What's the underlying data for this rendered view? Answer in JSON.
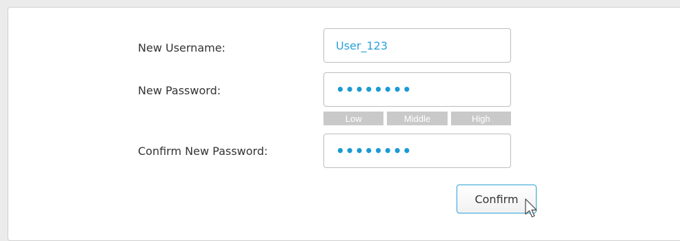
{
  "form": {
    "username_label": "New Username:",
    "username_value": "User_123",
    "password_label": "New Password:",
    "password_value": "••••••••",
    "confirm_label": "Confirm New Password:",
    "confirm_value": "••••••••"
  },
  "strength": {
    "low": "Low",
    "middle": "Middle",
    "high": "High"
  },
  "buttons": {
    "confirm": "Confirm"
  },
  "colors": {
    "accent": "#2aa1d9",
    "strength_bar": "#c9c9c9"
  },
  "icons": {
    "cursor": "mouse-pointer-icon"
  }
}
